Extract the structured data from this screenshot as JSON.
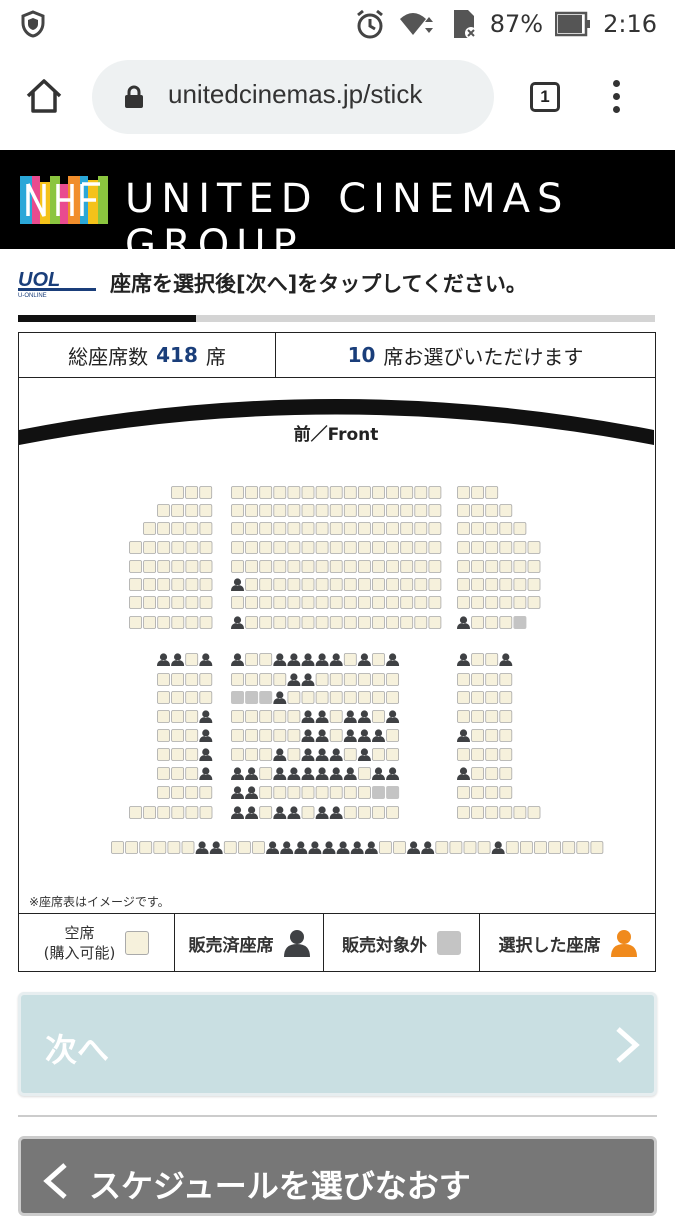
{
  "status_bar": {
    "battery": "87%",
    "time": "2:16",
    "icons": [
      "shield-icon",
      "alarm-icon",
      "wifi-icon",
      "sd-card-icon",
      "battery-icon"
    ]
  },
  "browser": {
    "url": "unitedcinemas.jp/stick",
    "tab_count": "1"
  },
  "banner": {
    "brand": "UNITED CINEMAS GROUP",
    "logo_text": ""
  },
  "instruction": {
    "logo": "U-ONLINE",
    "text": "座席を選択後[次へ]をタップしてください。",
    "progress": 0.28
  },
  "counts": {
    "total_label": "総座席数",
    "total": "418",
    "total_unit": "席",
    "select_count": "10",
    "select_text": "席お選びいただけます"
  },
  "seat_map": {
    "screen_label": "前／Front",
    "note": "※座席表はイメージです。"
  },
  "legend": {
    "available": "空席\n(購入可能)",
    "sold": "販売済座席",
    "unavailable": "販売対象外",
    "selected": "選択した座席"
  },
  "colors": {
    "available": "#f6f1dc",
    "sold": "#3f4144",
    "unavailable": "#c4c4c4",
    "selected": "#f08a1c",
    "next_button": "#c9dfe2"
  },
  "buttons": {
    "next": "次へ",
    "back": "スケジュールを選びなおす"
  }
}
